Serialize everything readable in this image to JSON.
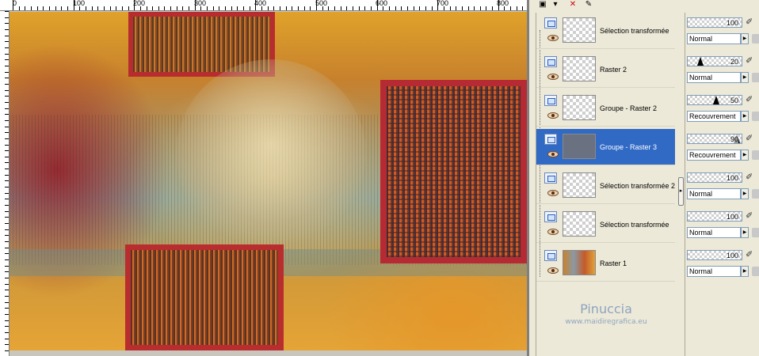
{
  "ruler": {
    "top_labels": [
      "0",
      "100",
      "200",
      "300",
      "400",
      "500",
      "600",
      "700",
      "800"
    ]
  },
  "canvas": {
    "image_description_icon": "artwork-image"
  },
  "layers": [
    {
      "name": "Sélection transformée"
    },
    {
      "name": "Raster 2"
    },
    {
      "name": "Groupe - Raster 2"
    },
    {
      "name": "Groupe - Raster 3",
      "selected": true
    },
    {
      "name": "Sélection transformée 2"
    },
    {
      "name": "Sélection transformée"
    },
    {
      "name": "Raster 1"
    }
  ],
  "properties": [
    {
      "opacity": "100",
      "opacity_level": 1.0,
      "blend": "Normal"
    },
    {
      "opacity": "20",
      "opacity_level": 0.2,
      "blend": "Normal"
    },
    {
      "opacity": "50",
      "opacity_level": 0.5,
      "blend": "Recouvrement"
    },
    {
      "opacity": "90",
      "opacity_level": 0.9,
      "blend": "Recouvrement"
    },
    {
      "opacity": "100",
      "opacity_level": 1.0,
      "blend": "Normal"
    },
    {
      "opacity": "100",
      "opacity_level": 1.0,
      "blend": "Normal"
    },
    {
      "opacity": "100",
      "opacity_level": 1.0,
      "blend": "Normal"
    }
  ],
  "watermark": {
    "title": "Pinuccia",
    "url": "www.maidiregrafica.eu"
  },
  "colors": {
    "selection": "#316ac5",
    "watermark": "#8fa4c0"
  },
  "toolbar_icons": [
    "new-layer-icon",
    "delete-layer-icon",
    "edit-icon"
  ]
}
